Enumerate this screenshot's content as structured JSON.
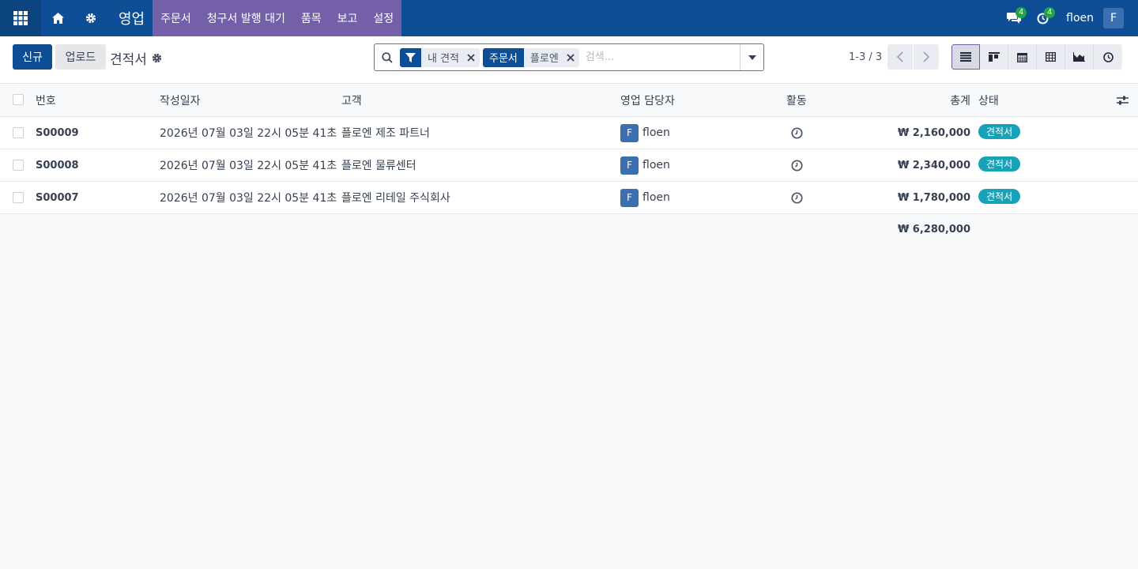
{
  "navbar": {
    "app_name": "영업",
    "menu": [
      "주문서",
      "청구서 발행 대기",
      "품목",
      "보고",
      "설정"
    ],
    "messages_count": "4",
    "activities_count": "4",
    "username": "floen",
    "avatar_letter": "F",
    "colors": {
      "bar": "#0d4e96",
      "menu": "#7460a8",
      "badge": "#22a346"
    }
  },
  "control": {
    "new_label": "신규",
    "upload_label": "업로드",
    "title": "견적서",
    "facets": [
      {
        "tag_icon": "filter-icon",
        "value": "내 견적"
      },
      {
        "tag": "주문서",
        "value": "플로엔"
      }
    ],
    "search_placeholder": "검색...",
    "pager": "1-3 / 3"
  },
  "table": {
    "headers": {
      "number": "번호",
      "date": "작성일자",
      "customer": "고객",
      "salesperson": "영업 담당자",
      "activity": "활동",
      "total": "총계",
      "state": "상태"
    },
    "rows": [
      {
        "number": "S00009",
        "date": "2026년 07월 03일 22시 05분 41초",
        "customer": "플로엔 제조 파트너",
        "sp_avatar": "F",
        "salesperson": "floen",
        "total": "₩ 2,160,000",
        "state": "견적서"
      },
      {
        "number": "S00008",
        "date": "2026년 07월 03일 22시 05분 41초",
        "customer": "플로엔 물류센터",
        "sp_avatar": "F",
        "salesperson": "floen",
        "total": "₩ 2,340,000",
        "state": "견적서"
      },
      {
        "number": "S00007",
        "date": "2026년 07월 03일 22시 05분 41초",
        "customer": "플로엔 리테일 주식회사",
        "sp_avatar": "F",
        "salesperson": "floen",
        "total": "₩ 1,780,000",
        "state": "견적서"
      }
    ],
    "grand_total": "₩ 6,280,000",
    "state_color": "#17a2b8"
  }
}
